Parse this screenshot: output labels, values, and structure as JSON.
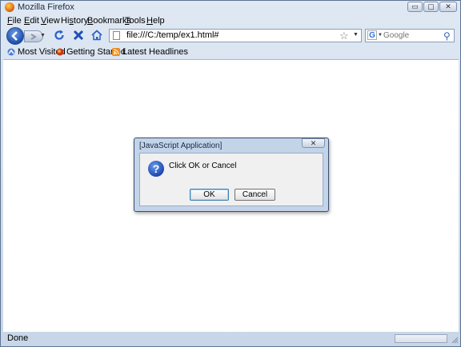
{
  "window": {
    "title": "Mozilla Firefox",
    "min_glyph": "▭",
    "max_glyph": "▢",
    "close_glyph": "✕"
  },
  "menu": [
    {
      "key": "F",
      "rest": "ile"
    },
    {
      "key": "E",
      "rest": "dit"
    },
    {
      "key": "V",
      "rest": "iew"
    },
    {
      "pre": "Hi",
      "key": "s",
      "rest": "tory"
    },
    {
      "key": "B",
      "rest": "ookmarks"
    },
    {
      "key": "T",
      "rest": "ools"
    },
    {
      "key": "H",
      "rest": "elp"
    }
  ],
  "navbar": {
    "url": "file:///C:/temp/ex1.html#",
    "search_placeholder": "Google",
    "search_engine_glyph": "G"
  },
  "bookmarks": [
    {
      "label": "Most Visited",
      "icon": "most-visited-icon"
    },
    {
      "label": "Getting Started",
      "icon": "firefox-icon"
    },
    {
      "label": "Latest Headlines",
      "icon": "rss-icon"
    }
  ],
  "status": {
    "text": "Done"
  },
  "dialog": {
    "title": "[JavaScript Application]",
    "message": "Click OK or Cancel",
    "ok_label": "OK",
    "cancel_label": "Cancel",
    "close_glyph": "✕",
    "icon": "question-icon"
  },
  "colors": {
    "chrome": "#cfd9e6",
    "accent": "#1e4fb0",
    "dialog_frame": "#c3d3e8"
  }
}
